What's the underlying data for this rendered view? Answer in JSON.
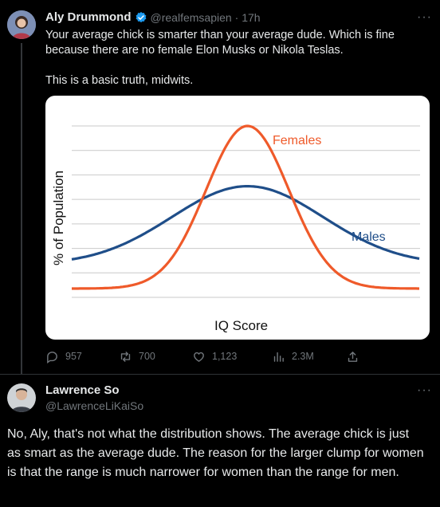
{
  "tweet": {
    "author_name": "Aly Drummond",
    "author_handle": "@realfemsapien",
    "time": "· 17h",
    "text_line1": "Your average chick is smarter than your average dude. Which is fine",
    "text_line2": "because there are no female Elon Musks or Nikola Teslas.",
    "text_line3": "This is a basic truth, midwits.",
    "more": "···",
    "stats": {
      "replies": "957",
      "reposts": "700",
      "likes": "1,123",
      "views": "2.3M"
    }
  },
  "chart_data": {
    "type": "line",
    "xlabel": "IQ Score",
    "ylabel": "% of Population",
    "series": [
      {
        "name": "Females",
        "color": "#ef5a2a",
        "peak": 1.0,
        "spread": "narrow"
      },
      {
        "name": "Males",
        "color": "#1f4e89",
        "peak": 0.56,
        "spread": "wide"
      }
    ],
    "grid": true
  },
  "reply": {
    "author_name": "Lawrence So",
    "author_handle": "@LawrenceLiKaiSo",
    "more": "···",
    "line1": "No, Aly, that's not what the distribution shows. The average chick is just",
    "line2": "as smart as the average dude. The reason for the larger clump for women",
    "line3": "is that the range is much narrower for women than the range for men."
  }
}
